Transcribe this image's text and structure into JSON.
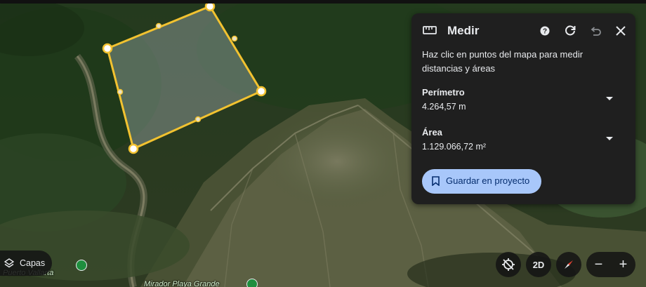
{
  "panel": {
    "title": "Medir",
    "instructions": "Haz clic en puntos del mapa para medir distancias y áreas",
    "perimeter_label": "Perímetro",
    "perimeter_value": "4.264,57 m",
    "area_label": "Área",
    "area_value": "1.129.066,72 m²",
    "save_label": "Guardar en proyecto",
    "icons": [
      "ruler-icon",
      "help-icon",
      "refresh-icon",
      "undo-icon",
      "close-icon",
      "chevron-down-icon",
      "bookmark-icon"
    ]
  },
  "layers": {
    "label": "Capas",
    "icon": "layers-icon"
  },
  "map_labels": {
    "place_1": "Puerto Vallarta",
    "place_2": "Mirador Playa Grande"
  },
  "controls": {
    "mode_label": "2D",
    "zoom_out": "−",
    "zoom_in": "+",
    "icons": [
      "location-disabled-icon",
      "compass-icon"
    ]
  },
  "colors": {
    "panel_bg": "#1f1f1f",
    "panel_text": "#e8eaed",
    "save_button_bg": "#a8c7fa",
    "save_button_text": "#062e6f",
    "measure_line": "#f2c230",
    "measure_fill": "rgba(190,200,210,0.35)"
  }
}
